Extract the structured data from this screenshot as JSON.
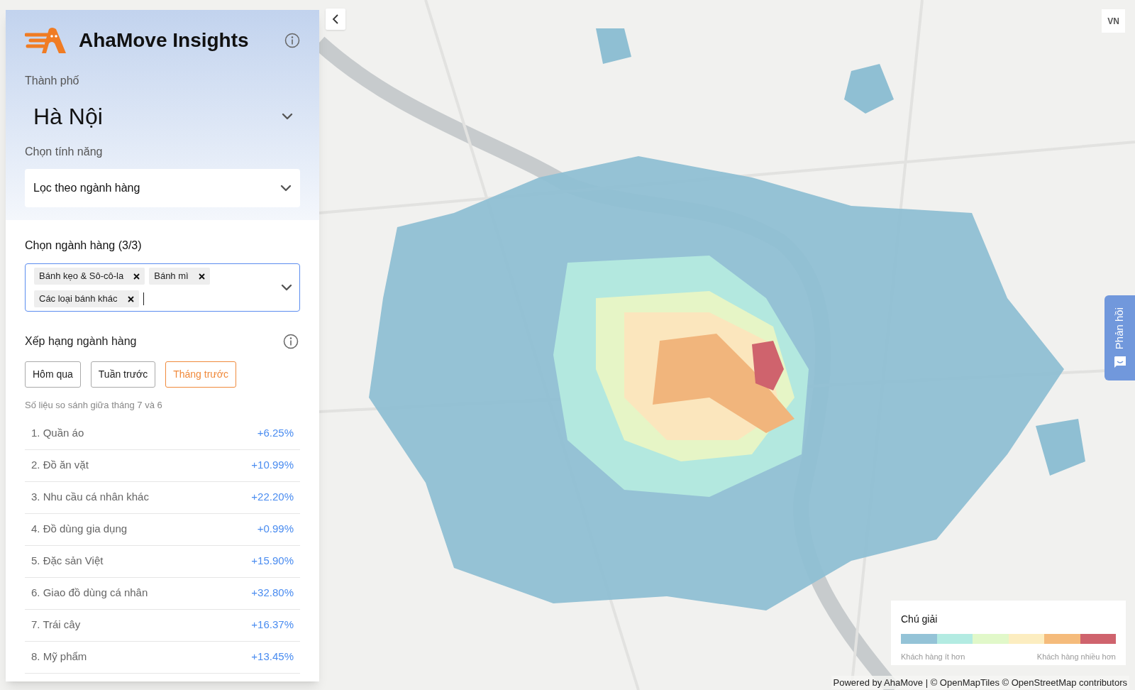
{
  "app": {
    "title": "AhaMove Insights"
  },
  "city": {
    "label": "Thành phố",
    "value": "Hà Nội"
  },
  "feature": {
    "label": "Chọn tính năng",
    "value": "Lọc theo ngành hàng"
  },
  "categories": {
    "label": "Chọn ngành hàng (3/3)",
    "tags": [
      "Bánh kẹo & Sô-cô-la",
      "Bánh mì",
      "Các loại bánh khác"
    ]
  },
  "ranking": {
    "title": "Xếp hạng ngành hàng",
    "periods": [
      {
        "label": "Hôm qua",
        "selected": false
      },
      {
        "label": "Tuần trước",
        "selected": false
      },
      {
        "label": "Tháng trước",
        "selected": true
      }
    ],
    "note": "Số liệu so sánh giữa tháng 7 và 6",
    "items": [
      {
        "label": "1. Quần áo",
        "change": "+6.25%"
      },
      {
        "label": "2. Đồ ăn vặt",
        "change": "+10.99%"
      },
      {
        "label": "3. Nhu cầu cá nhân khác",
        "change": "+22.20%"
      },
      {
        "label": "4. Đồ dùng gia dụng",
        "change": "+0.99%"
      },
      {
        "label": "5. Đặc sản Việt",
        "change": "+15.90%"
      },
      {
        "label": "6. Giao đồ dùng cá nhân",
        "change": "+32.80%"
      },
      {
        "label": "7. Trái cây",
        "change": "+16.37%"
      },
      {
        "label": "8. Mỹ phẩm",
        "change": "+13.45%"
      }
    ]
  },
  "map": {
    "region_button": "VN",
    "feedback": "Phản hồi",
    "legend": {
      "title": "Chú giải",
      "scale": [
        {
          "color": "#94c3d7"
        },
        {
          "color": "#b3ebe2"
        },
        {
          "color": "#e1f8c9"
        },
        {
          "color": "#fcedc0"
        },
        {
          "color": "#f5bb7b"
        },
        {
          "color": "#cf636d"
        }
      ],
      "low": "Khách hàng ít hơn",
      "high": "Khách hàng nhiều hơn"
    },
    "attribution": "Powered by AhaMove | © OpenMapTiles © OpenStreetMap contributors"
  }
}
